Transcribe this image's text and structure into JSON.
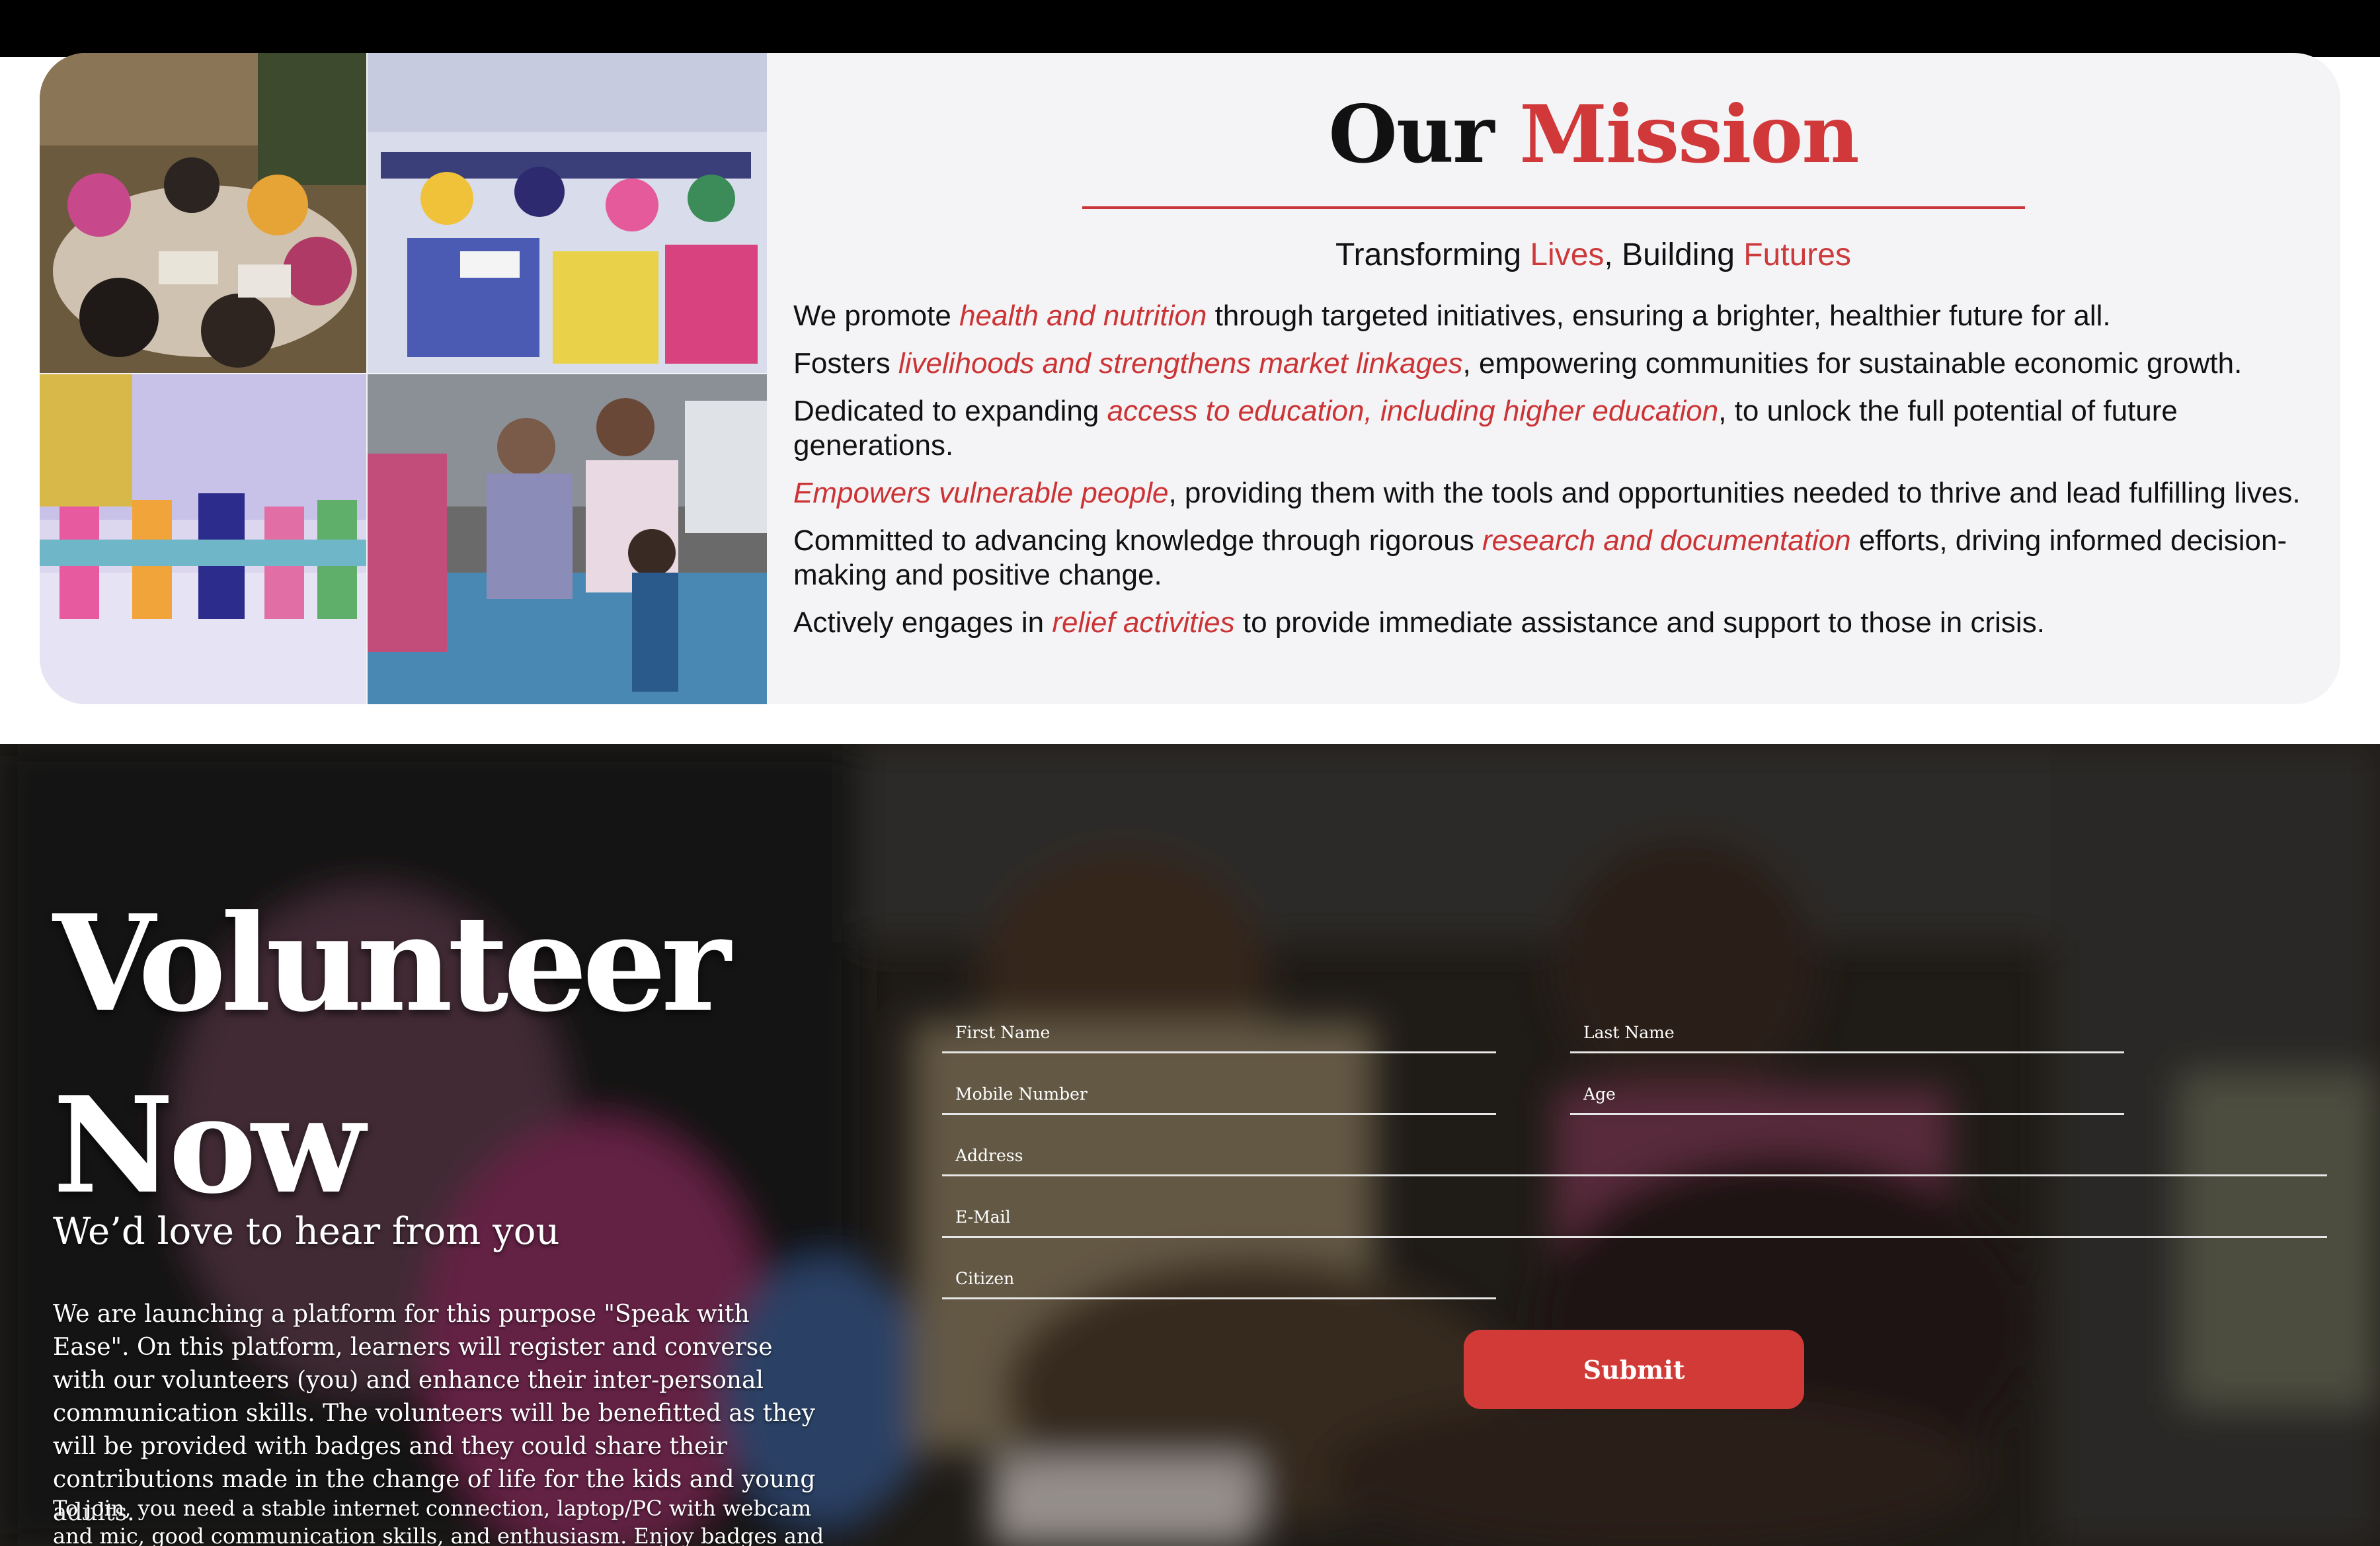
{
  "mission": {
    "title_plain": "Our",
    "title_accent": "Mission",
    "subtitle": {
      "part1": "Transforming ",
      "accent1": "Lives",
      "part2": ", Building ",
      "accent2": "Futures"
    },
    "items": [
      {
        "pre": "We promote ",
        "em": "health and nutrition",
        "post": " through targeted initiatives, ensuring a brighter, healthier future for all."
      },
      {
        "pre": "Fosters ",
        "em": "livelihoods and strengthens market linkages",
        "post": ", empowering communities for sustainable economic growth."
      },
      {
        "pre": "Dedicated to expanding ",
        "em": "access to education, including higher education",
        "post": ", to unlock the full potential of future generations."
      },
      {
        "pre": "",
        "em": "Empowers vulnerable people",
        "post": ", providing them with the tools and opportunities needed to thrive and lead fulfilling lives."
      },
      {
        "pre": "Committed to advancing knowledge through rigorous ",
        "em": "research and documentation",
        "post": " efforts, driving informed decision-making and positive change."
      },
      {
        "pre": "Actively engages in ",
        "em": "relief activities",
        "post": " to provide immediate assistance and support to those in crisis."
      }
    ]
  },
  "volunteer": {
    "title_line1": "Volunteer",
    "title_line2": "Now",
    "tagline": "We’d love to hear from you",
    "paragraph1": "We are launching a platform for this purpose \"Speak with Ease\". On this platform, learners will register and converse with our volunteers (you) and enhance their inter-personal communication skills. The volunteers will be benefitted as they will be provided with badges and they could share their contributions made in the change of life for the kids and young adults.",
    "paragraph2": "To join, you need a stable internet connection, laptop/PC with webcam and mic, good communication skills, and enthusiasm. Enjoy badges and appreciation letters as",
    "form": {
      "first_name_placeholder": "First Name",
      "last_name_placeholder": "Last Name",
      "mobile_placeholder": "Mobile Number",
      "age_placeholder": "Age",
      "address_placeholder": "Address",
      "email_placeholder": "E-Mail",
      "citizen_placeholder": "Citizen",
      "submit_label": "Submit"
    }
  },
  "colors": {
    "accent_red": "#d0383a",
    "button_red": "#d23a37",
    "card_bg": "#f4f4f6"
  }
}
